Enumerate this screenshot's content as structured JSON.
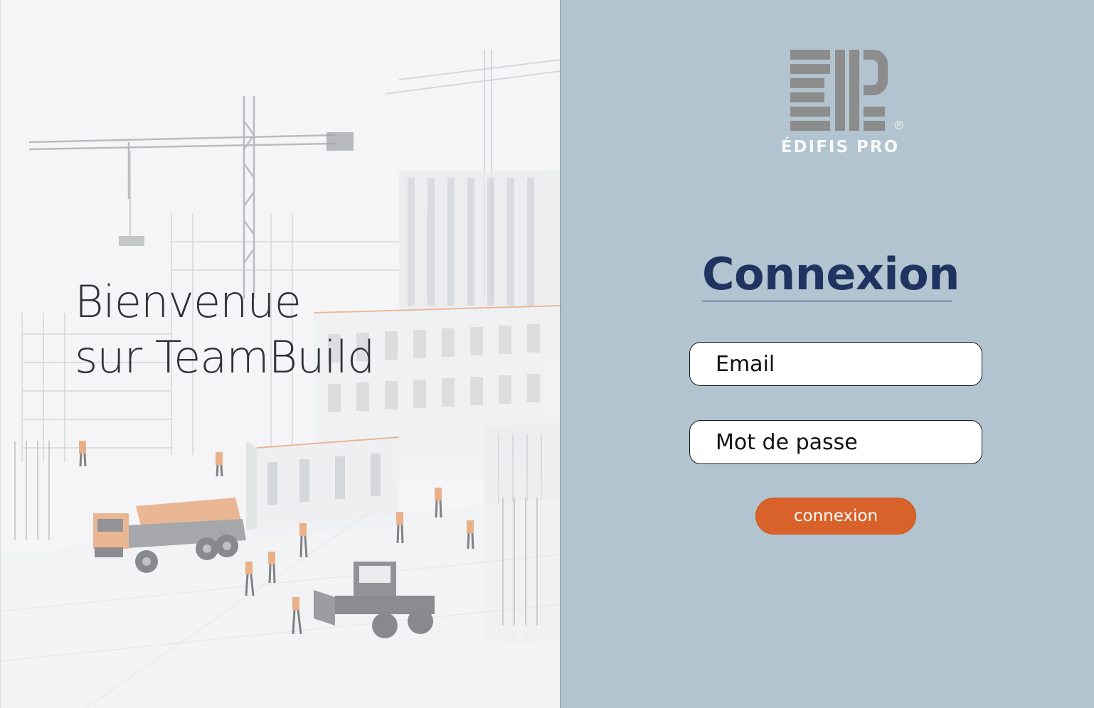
{
  "hero": {
    "welcome_line1": "Bienvenue",
    "welcome_line2": "sur TeamBuild",
    "image_subject": "construction-site-illustration"
  },
  "brand": {
    "logo_icon": "edifis-pro-logo",
    "name": "ÉDIFIS PRO",
    "trademark": "M"
  },
  "login": {
    "title": "Connexion",
    "email_placeholder": "Email",
    "password_placeholder": "Mot de passe",
    "submit_label": "connexion"
  },
  "colors": {
    "panel_background": "#b2c4cf",
    "title": "#1f3460",
    "button": "#d9622b",
    "logo_gray": "#8e8e8e"
  }
}
